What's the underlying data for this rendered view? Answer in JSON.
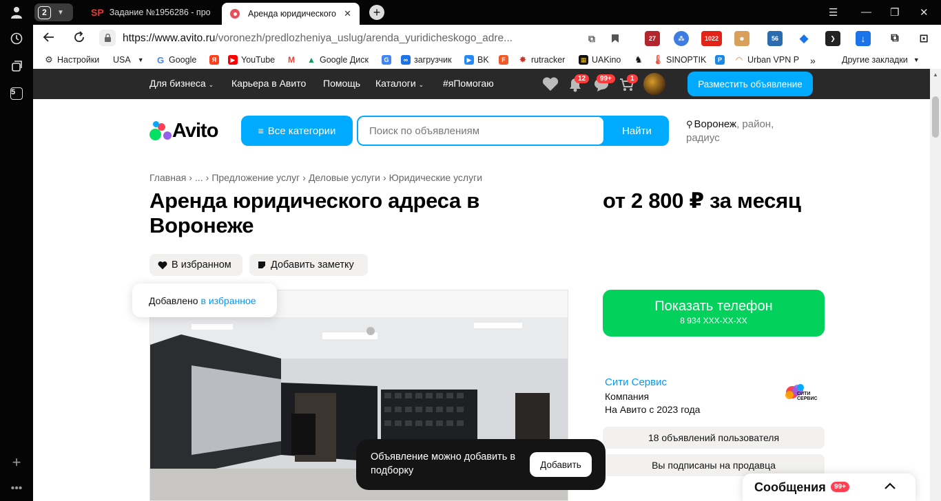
{
  "browser": {
    "tab_count": "2",
    "tabs": [
      {
        "prefix": "SP",
        "title": "Задание №1956286 - про"
      },
      {
        "title": "Аренда юридического"
      }
    ],
    "url_host": "https://www.avito.ru",
    "url_path": "/voronezh/predlozheniya_uslug/arenda_yuridicheskogo_adre...",
    "ext_badges": {
      "e1": "27",
      "e3": "1022",
      "e6": "56"
    },
    "sidebar_counter": "5"
  },
  "bookmarks": [
    {
      "label": "Настройки"
    },
    {
      "label": "USA"
    },
    {
      "label": "Google"
    },
    {
      "label": "YouTube"
    },
    {
      "label": "Google Диск"
    },
    {
      "label": "загрузчик"
    },
    {
      "label": "BK"
    },
    {
      "label": "rutracker"
    },
    {
      "label": "UAKino"
    },
    {
      "label": "SINOPTIK"
    },
    {
      "label": "Urban VPN P"
    },
    {
      "label": "Другие закладки"
    }
  ],
  "site_nav": {
    "business": "Для бизнеса",
    "career": "Карьера в Авито",
    "help": "Помощь",
    "catalogs": "Каталоги",
    "help_tag": "#яПомогаю",
    "notif_badge": "12",
    "msg_badge": "99+",
    "cart_badge": "1",
    "post_button": "Разместить объявление"
  },
  "header": {
    "logo": "Avito",
    "categories_button": "Все категории",
    "search_placeholder": "Поиск по объявлениям",
    "search_button": "Найти",
    "location_city": "Воронеж",
    "location_rest": ", район, радиус"
  },
  "breadcrumbs": [
    "Главная",
    "...",
    "Предложение услуг",
    "Деловые услуги",
    "Юридические услуги"
  ],
  "listing": {
    "title": "Аренда юридического адреса в Воронеже",
    "price": "от 2 800 ₽ за месяц",
    "fav_button": "В избранном",
    "note_button": "Добавить заметку",
    "fav_toast_text": "Добавлено",
    "fav_toast_link": "в избранное"
  },
  "contact": {
    "phone_button": "Показать телефон",
    "phone_masked": "8 934 XXX-XX-XX"
  },
  "seller": {
    "name": "Сити Сервис",
    "type": "Компания",
    "since": "На Авито с 2023 года",
    "logo_text_1": "СИТИ",
    "logo_text_2": "СЕРВИС",
    "listings": "18 объявлений пользователя",
    "subscribed": "Вы подписаны на продавца"
  },
  "collection_toast": {
    "text": "Объявление можно добавить в подборку",
    "button": "Добавить"
  },
  "messages": {
    "label": "Сообщения",
    "count": "99+"
  },
  "colors": {
    "accent_blue": "#00aaff",
    "phone_green": "#02d15c",
    "link_blue": "#0099f7",
    "badge_red": "#ff3b3b"
  }
}
